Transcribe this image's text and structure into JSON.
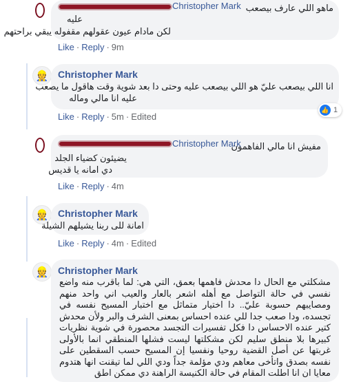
{
  "actions": {
    "like": "Like",
    "reply": "Reply",
    "dot": "·",
    "edited": "Edited"
  },
  "comments": [
    {
      "author": "Christopher Mark",
      "lines": [
        "ماهو اللي عارف بيصعب",
        "عليه",
        "لكن مادام عيون عقولهم مقفوله يبقي براحتهم"
      ],
      "time": "9m"
    },
    {
      "author": "Christopher Mark",
      "lines": [
        "انا اللي بيصعب عليّ هو اللي بيصعب عليه وحتى دا بعد شوية وقت هاقول ما يصعب",
        "عليه انا مالي وماله"
      ],
      "time": "5m",
      "reaction_count": "1"
    },
    {
      "author": "Christopher Mark",
      "lines": [
        "مفيش انا مالي الفاهمون",
        "يضيئون كضياء الجلد",
        "دي امانه يا قديس"
      ],
      "time": "4m"
    },
    {
      "author": "Christopher Mark",
      "lines": [
        "امانة للى ربنا يشيلهم الشيلة"
      ],
      "time": "4m"
    },
    {
      "author": "Christopher Mark",
      "text": "مشكلتي مع الحال دا محدش فاهمها بعمق، التي هي: لما باقرب منه واضع نفسي في حالة التواصل مع أهله اشعر بالعار والعيب اني واحد منهم ومصايبهم حسوبة عليّ.. دا اختيار متماثل مع اختبار المسيح نفسه في تجسده، ودا صعب جدا للي عنده احساس بمعنى الشرف والبر ولأن محدش كتير عنده الاحساس دا فكل تفسيرات التجسد محصورة في شوية نظريات كبيرها بلا منطق سليم لكن مشكلتها ليست فشلها المنطقي انما بالأولى غربتها عن أصل القضية روحيا ونفسيا إن المسيح حسب السقطين على نفسه بصدق واتأخى معاهم ودي مؤلمة جداً ودي اللي لما تيقنت انها هتدوم معايا ان انا اطلت المقام في حالة الكنيسة الراهنة دي ممكن اطق"
    }
  ]
}
